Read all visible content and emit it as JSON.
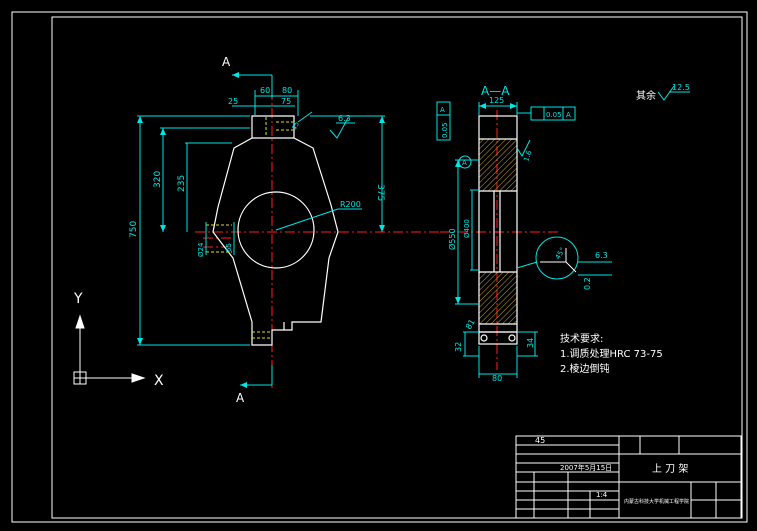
{
  "colors": {
    "background": "#000000",
    "frame": "#ffffff",
    "outline": "#ffffff",
    "dimension": "#00e5e5",
    "center_line": "#ff2020",
    "hatch": "#c8a030",
    "hidden": "#e0e020"
  },
  "front_view": {
    "section_mark_top": "A",
    "section_mark_bottom": "A",
    "dims": {
      "d60": "60",
      "d80": "80",
      "d25": "25",
      "d75": "75",
      "d45": "45",
      "d375": "375",
      "d320": "320",
      "d235": "235",
      "d750": "750",
      "r200": "R200",
      "phi24": "Ø24",
      "d65": "65"
    },
    "roughness": "6.3"
  },
  "section_view": {
    "title": "A—A",
    "d125": "125",
    "tolerance_flat": "0.05",
    "tolerance_flat_datum": "A",
    "tolerance_par": "0.05",
    "tolerance_par_datum": "A",
    "datum_label": "A",
    "roughness_side": "1.6",
    "dia_left": "Ø550",
    "dia_inner": "Ø400",
    "detail_dim": "6.3",
    "detail_dim2": "0.2",
    "detail_ang": "45°",
    "d81": "81",
    "d32": "32",
    "d34": "34",
    "d80": "80"
  },
  "other_roughness": {
    "label": "其余",
    "value": "12.5"
  },
  "tech_requirements": {
    "title": "技术要求:",
    "items": [
      "1.调质处理HRC 73-75",
      "2.棱边倒钝"
    ]
  },
  "title_block": {
    "material": "45",
    "part_name": "上 刀 架",
    "date_code": "2007年5月15日",
    "scale": "1:4",
    "company": "内蒙古科技大学机械工程学院"
  },
  "ucs": {
    "x_label": "X",
    "y_label": "Y"
  }
}
